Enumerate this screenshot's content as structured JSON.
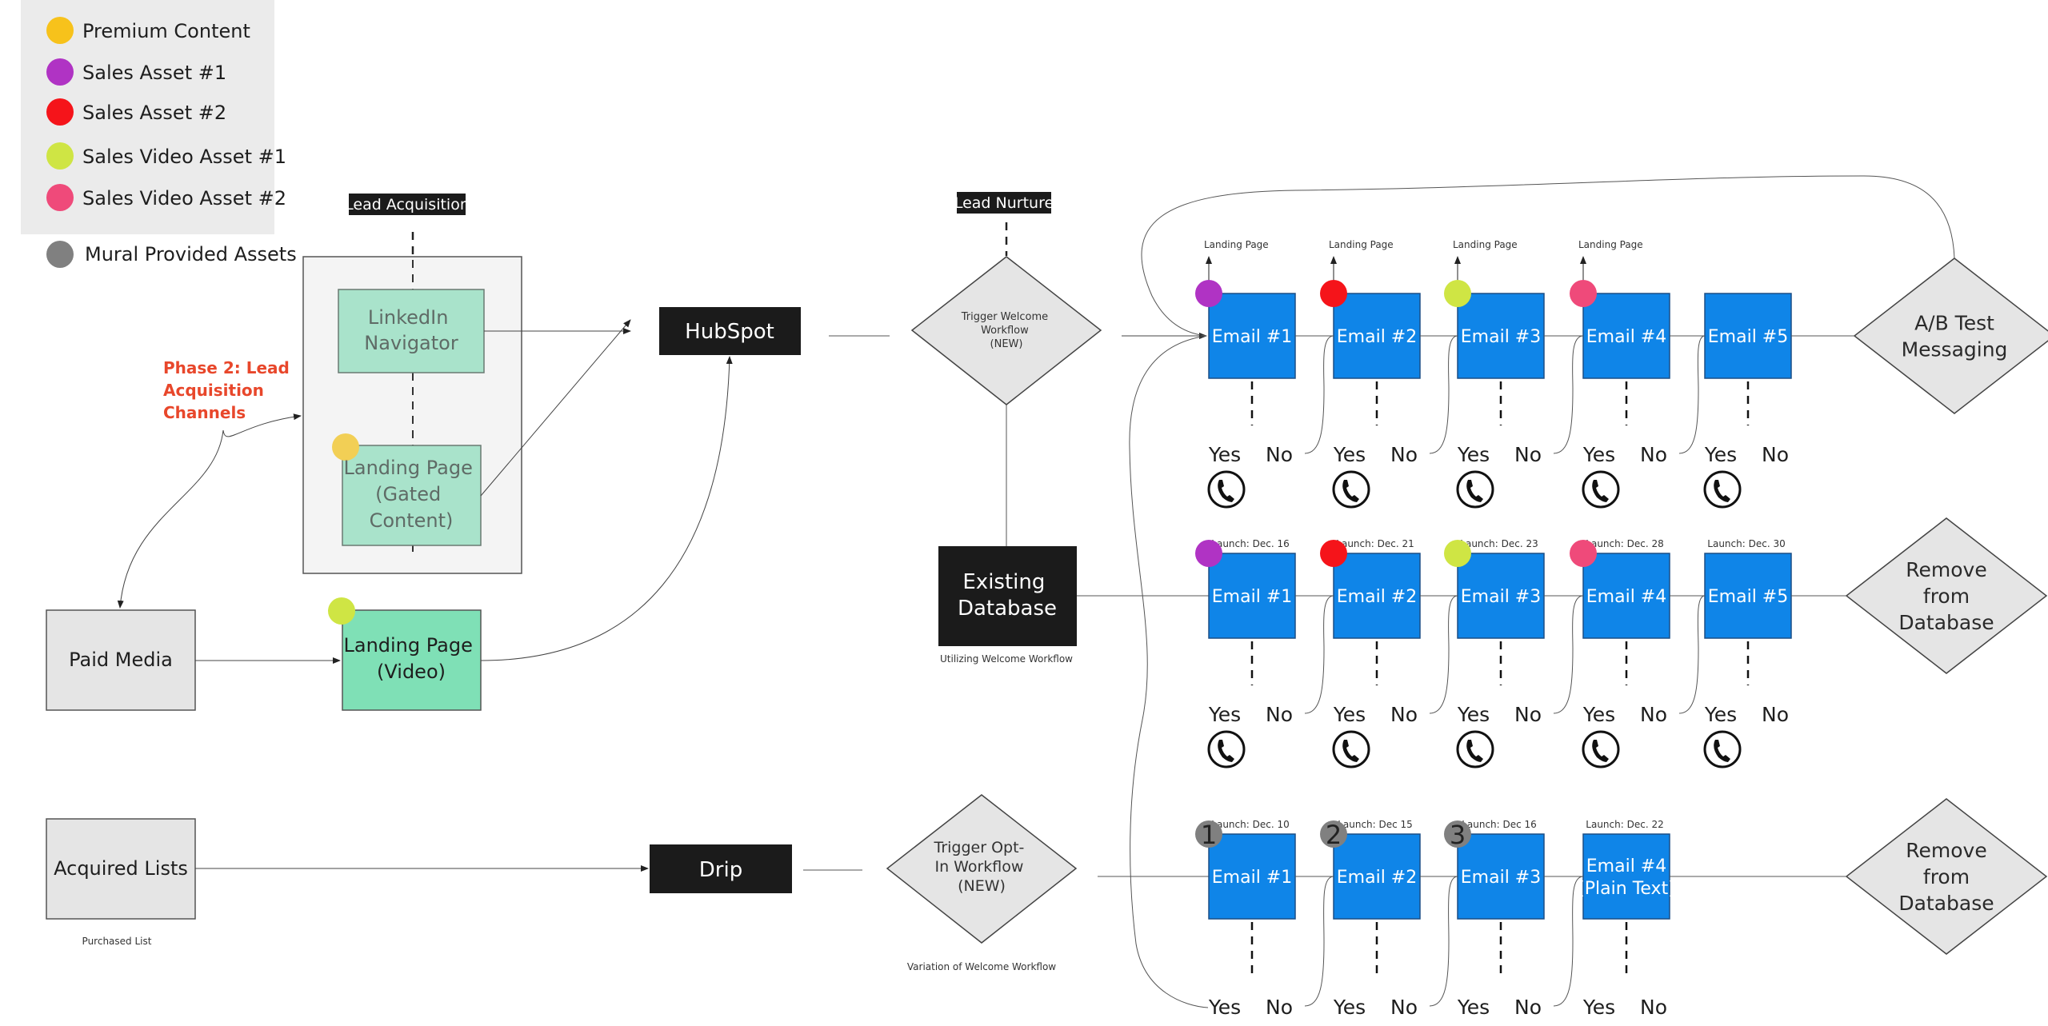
{
  "legend": {
    "items": [
      {
        "label": "Premium Content",
        "color": "#f7c21b"
      },
      {
        "label": "Sales Asset #1",
        "color": "#b033c4"
      },
      {
        "label": "Sales Asset #2",
        "color": "#f5141a"
      },
      {
        "label": "Sales Video Asset #1",
        "color": "#cfe544"
      },
      {
        "label": "Sales Video Asset #2",
        "color": "#ef4a7a"
      }
    ],
    "mural": {
      "label": "Mural Provided Assets",
      "color": "#808080"
    }
  },
  "acquisition": {
    "section_label": "Lead Acquisition",
    "phase_note": [
      "Phase 2: Lead",
      "Acquisition",
      "Channels"
    ],
    "linkedin": [
      "LinkedIn",
      "Navigator"
    ],
    "landing_gated": [
      "Landing Page",
      "(Gated",
      "Content)"
    ],
    "paid_media": "Paid Media",
    "landing_video": [
      "Landing Page",
      "(Video)"
    ],
    "acquired_lists": "Acquired Lists",
    "purchased_caption": "Purchased List"
  },
  "platforms": {
    "hubspot": "HubSpot",
    "drip": "Drip",
    "existing_db": [
      "Existing",
      "Database"
    ],
    "existing_db_caption": "Utilizing Welcome Workflow"
  },
  "nurture": {
    "section_label": "Lead Nurture",
    "trigger_welcome": [
      "Trigger Welcome",
      "Workflow",
      "(NEW)"
    ],
    "trigger_optin": [
      "Trigger Opt-",
      "In Workflow",
      "(NEW)"
    ],
    "trigger_optin_caption": "Variation of Welcome Workflow"
  },
  "yes_label": "Yes",
  "no_label": "No",
  "rows": [
    {
      "name": "hubspot-welcome",
      "emails": [
        {
          "label": [
            "Email #1"
          ],
          "top_note": "Landing Page",
          "asset": "Sales Asset #1",
          "asset_color": "#b033c4",
          "call": true
        },
        {
          "label": [
            "Email #2"
          ],
          "top_note": "Landing Page",
          "asset": "Sales Asset #2",
          "asset_color": "#f5141a",
          "call": true
        },
        {
          "label": [
            "Email #3"
          ],
          "top_note": "Landing Page",
          "asset": "Sales Video Asset #1",
          "asset_color": "#cfe544",
          "call": true
        },
        {
          "label": [
            "Email #4"
          ],
          "top_note": "Landing Page",
          "asset": "Sales Video Asset #2",
          "asset_color": "#ef4a7a",
          "call": true
        },
        {
          "label": [
            "Email #5"
          ],
          "top_note": "",
          "asset": "",
          "asset_color": "",
          "call": true
        }
      ],
      "end_decision": [
        "A/B Test",
        "Messaging"
      ]
    },
    {
      "name": "existing-database",
      "emails": [
        {
          "label": [
            "Email #1"
          ],
          "top_note": "Launch: Dec. 16",
          "asset": "Sales Asset #1",
          "asset_color": "#b033c4",
          "call": true
        },
        {
          "label": [
            "Email #2"
          ],
          "top_note": "Launch: Dec. 21",
          "asset": "Sales Asset #2",
          "asset_color": "#f5141a",
          "call": true
        },
        {
          "label": [
            "Email #3"
          ],
          "top_note": "Launch: Dec. 23",
          "asset": "Sales Video Asset #1",
          "asset_color": "#cfe544",
          "call": true
        },
        {
          "label": [
            "Email #4"
          ],
          "top_note": "Launch: Dec. 28",
          "asset": "Sales Video Asset #2",
          "asset_color": "#ef4a7a",
          "call": true
        },
        {
          "label": [
            "Email #5"
          ],
          "top_note": "Launch: Dec. 30",
          "asset": "",
          "asset_color": "",
          "call": true
        }
      ],
      "end_decision": [
        "Remove",
        "from",
        "Database"
      ]
    },
    {
      "name": "drip-optin",
      "emails": [
        {
          "label": [
            "Email #1"
          ],
          "top_note": "Launch: Dec. 10",
          "asset": "1",
          "asset_color": "#808080",
          "call": false
        },
        {
          "label": [
            "Email #2"
          ],
          "top_note": "Launch: Dec 15",
          "asset": "2",
          "asset_color": "#808080",
          "call": false
        },
        {
          "label": [
            "Email #3"
          ],
          "top_note": "Launch: Dec 16",
          "asset": "3",
          "asset_color": "#808080",
          "call": false
        },
        {
          "label": [
            "Email #4",
            "(Plain Text)"
          ],
          "top_note": "Launch: Dec. 22",
          "asset": "",
          "asset_color": "",
          "call": false
        }
      ],
      "end_decision": [
        "Remove",
        "from",
        "Database"
      ]
    }
  ],
  "colors": {
    "email_blue": "#0f85e8",
    "dark_box": "#1b1b1b",
    "mint": "#a9e3cb",
    "mint_bright": "#7fe0b6",
    "grey_box": "#e5e5e5",
    "legend_bg": "#ebebeb",
    "phase_red": "#e8472b"
  }
}
